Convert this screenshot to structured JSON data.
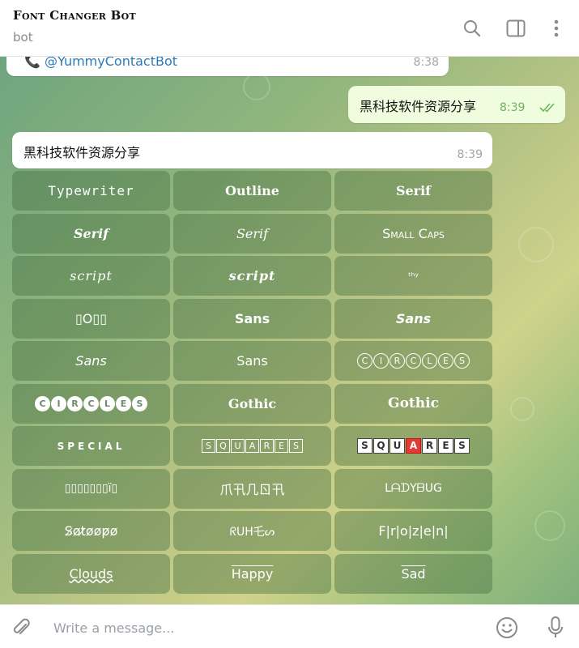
{
  "header": {
    "title": "Font Changer Bot",
    "subtitle": "bot",
    "icons": [
      "search-icon",
      "sidebar-toggle-icon",
      "more-vertical-icon"
    ]
  },
  "messages": [
    {
      "direction": "in",
      "text": "📞 @YummyContactBot",
      "time": "8:38"
    },
    {
      "direction": "out",
      "text": "黑科技软件资源分享",
      "time": "8:39",
      "read": true
    },
    {
      "direction": "in",
      "text": "黑科技软件资源分享",
      "time": "8:39"
    }
  ],
  "keyboard": {
    "buttons": [
      "Typewriter",
      "Outline",
      "Serif",
      "Serif",
      "Serif",
      "Small Caps",
      "script",
      "script",
      "ᵗʰʸ",
      "▯O▯▯",
      "Sans",
      "Sans",
      "Sans",
      "Sans",
      "CIRCLES",
      "CIRCLES",
      "Gothic",
      "Gothic",
      "SPECIAL",
      "SQUARES",
      "SQUARES",
      "▯▯▯▯▯▯▯ï▯",
      "爪卂几ㄖ卂",
      "ᒪᗩᗪYᗷᑌG",
      "S̷o̷t̷o̷o̷p̷o̷",
      "ᖇᑌᕼ乇ᔕ",
      "F|r|o|z|e|n|",
      "Clouds",
      "Happy",
      "Sad"
    ],
    "circles_letters": [
      "C",
      "I",
      "R",
      "C",
      "L",
      "E",
      "S"
    ],
    "squares_letters": [
      "S",
      "Q",
      "U",
      "A",
      "R",
      "E",
      "S"
    ]
  },
  "composer": {
    "placeholder": "Write a message...",
    "icons": [
      "attach-icon",
      "emoji-icon",
      "microphone-icon"
    ]
  },
  "colors": {
    "accent": "#4fae4e",
    "read_check": "#4fae4e",
    "button_overlay": "#5b8a55"
  }
}
